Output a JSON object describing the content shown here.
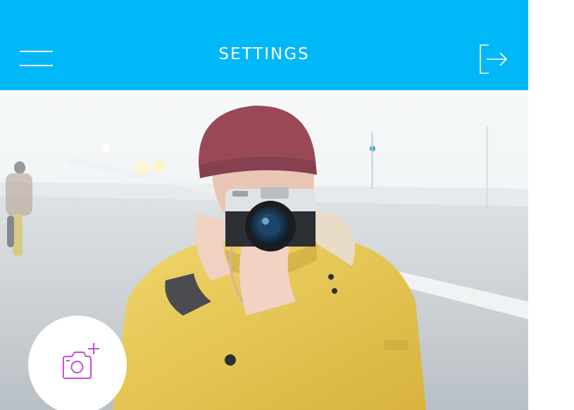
{
  "header": {
    "title": "SETTINGS",
    "menu_icon": "hamburger-menu-icon",
    "logout_icon": "logout-icon",
    "background_color": "#00b7f7"
  },
  "profile": {
    "photo_description_icon": "cover-photo",
    "change_photo_icon": "camera-add-icon",
    "accent_color": "#c94fd2"
  }
}
